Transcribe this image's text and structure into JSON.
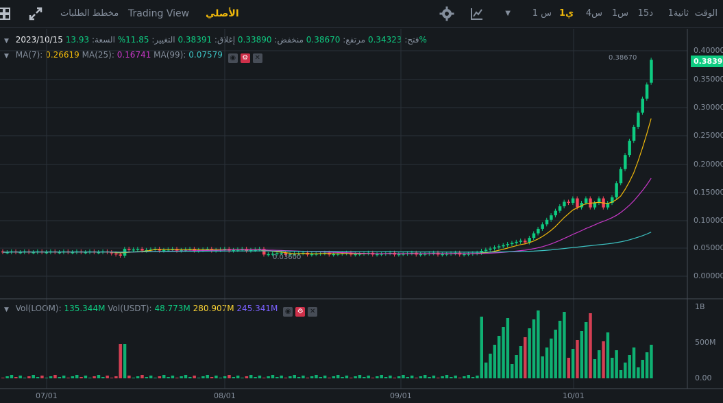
{
  "toolbar": {
    "time_label": "الوقت",
    "intervals": [
      "1ثانية",
      "15د",
      "1س",
      "4س",
      "1ي",
      "1 س"
    ],
    "active_interval": "1ي",
    "views": {
      "original": "الأصلي",
      "tradingview": "Trading View",
      "depth": "مخطط الطلبات"
    },
    "active_view": "الأصلي",
    "icons": {
      "settings": "gear-icon",
      "indicators": "chart-indicator-icon",
      "more": "caret-down-icon",
      "expand": "expand-icon",
      "grid": "grid-icon"
    }
  },
  "ohlc": {
    "date": "2023/10/15",
    "open_label": "فتح:",
    "open": "0.34323",
    "high_label": "مرتفع:",
    "high": "0.38670",
    "low_label": "منخفض:",
    "low": "0.33890",
    "close_label": "إغلاق:",
    "close": "0.38391",
    "change_label": "التغيير:",
    "change": "11.85%",
    "amplitude_label": "السعة:",
    "amplitude": "13.93%"
  },
  "ma": {
    "ma7_label": "MA(7):",
    "ma7": "0.26619",
    "ma25_label": "MA(25):",
    "ma25": "0.16741",
    "ma99_label": "MA(99):",
    "ma99": "0.07579"
  },
  "vol": {
    "vol_loom_label": "Vol(LOOM):",
    "vol_loom": "135.344M",
    "vol_usdt_label": "Vol(USDT):",
    "vol_usdt": "48.773M",
    "vol_ma1": "280.907M",
    "vol_ma2": "245.341M"
  },
  "price_axis": [
    "0.40000",
    "0.35000",
    "0.30000",
    "0.25000",
    "0.20000",
    "0.15000",
    "0.10000",
    "0.05000",
    "0.00000"
  ],
  "volume_axis": [
    "1B",
    "500M",
    "0.00"
  ],
  "time_axis": [
    "07/01",
    "08/01",
    "09/01",
    "10/01"
  ],
  "current_price": "0.38391",
  "high_marker": "0.38670",
  "low_marker": "0.03600",
  "colors": {
    "up": "#0ecb81",
    "down": "#f6465d",
    "ma7": "#f0b90b",
    "ma25": "#c938c9",
    "ma99": "#3dc4c4",
    "active": "#f0b90b",
    "bg": "#161a1e"
  }
}
